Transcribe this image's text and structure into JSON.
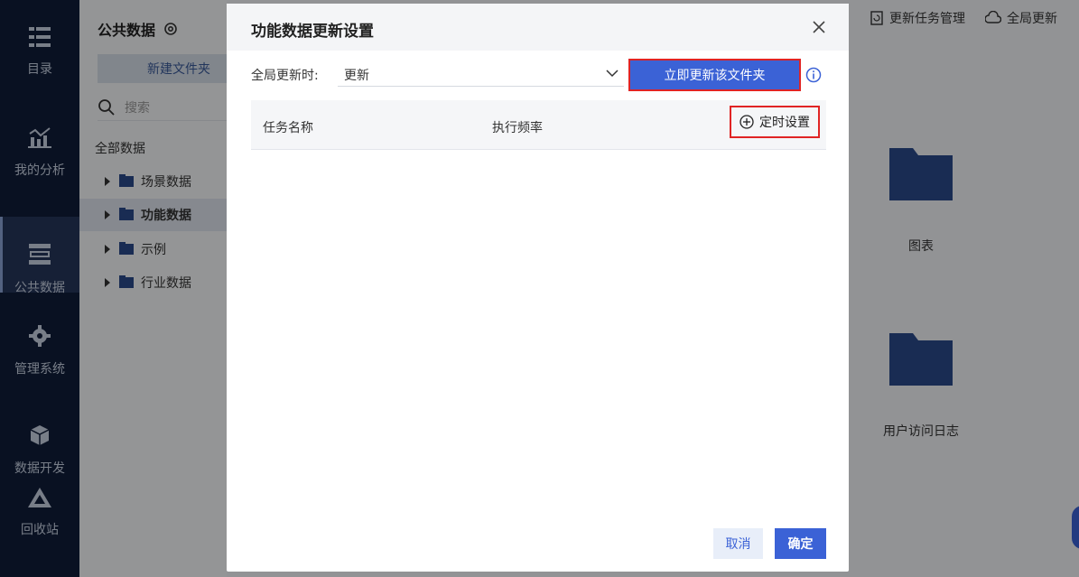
{
  "nav": {
    "items": [
      {
        "label": "目录",
        "icon": "list-icon",
        "active": false
      },
      {
        "label": "我的分析",
        "icon": "chart-icon",
        "active": false
      },
      {
        "label": "公共数据",
        "icon": "database-icon",
        "active": true
      },
      {
        "label": "管理系统",
        "icon": "gear-cog-icon",
        "active": false
      },
      {
        "label": "数据开发",
        "icon": "cube-icon",
        "active": false
      },
      {
        "label": "回收站",
        "icon": "recycle-icon",
        "active": false
      }
    ]
  },
  "sidebar": {
    "title": "公共数据",
    "new_folder_label": "新建文件夹",
    "search_placeholder": "搜索",
    "all_data_label": "全部数据",
    "tree": [
      {
        "label": "场景数据",
        "active": false
      },
      {
        "label": "功能数据",
        "active": true
      },
      {
        "label": "示例",
        "active": false
      },
      {
        "label": "行业数据",
        "active": false
      }
    ]
  },
  "toolbar": {
    "task_mgmt_label": "更新任务管理",
    "global_update_label": "全局更新"
  },
  "main": {
    "files": [
      {
        "label": "图表"
      },
      {
        "label": "用户访问日志"
      }
    ]
  },
  "modal": {
    "title": "功能数据更新设置",
    "global_update_label": "全局更新时:",
    "select_value": "更新",
    "update_now_label": "立即更新该文件夹",
    "col_task_name": "任务名称",
    "col_frequency": "执行频率",
    "schedule_label": "定时设置",
    "cancel_label": "取消",
    "ok_label": "确定"
  },
  "colors": {
    "primary": "#3b62d6",
    "nav_bg": "#0f1d3a",
    "highlight_border": "#e02424"
  }
}
